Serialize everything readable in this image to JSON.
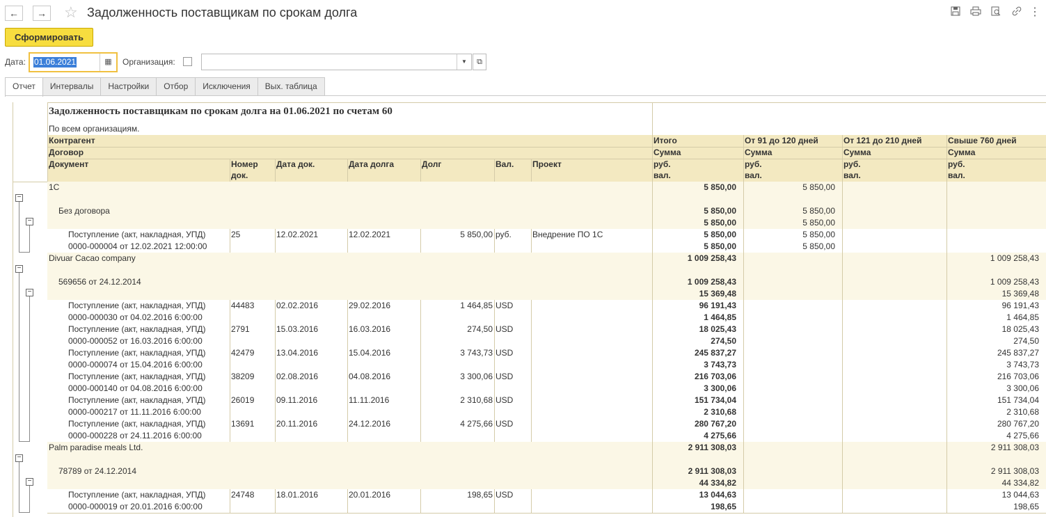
{
  "window": {
    "title": "Задолженность поставщикам по срокам долга",
    "back_icon": "←",
    "forward_icon": "→",
    "star_icon": "☆"
  },
  "toolbar": {
    "generate_label": "Сформировать"
  },
  "filters": {
    "date_label": "Дата:",
    "date_value": "01.06.2021",
    "org_label": "Организация:",
    "org_value": ""
  },
  "tabs": [
    "Отчет",
    "Интервалы",
    "Настройки",
    "Отбор",
    "Исключения",
    "Вых. таблица"
  ],
  "report": {
    "title": "Задолженность поставщикам по срокам долга на 01.06.2021  по счетам 60",
    "subtitle": "По всем организациям.",
    "headers": {
      "counterparty": "Контрагент",
      "contract": "Договор",
      "document": "Документ",
      "doc_number": [
        "Номер",
        "док."
      ],
      "doc_date": "Дата док.",
      "debt_date": "Дата долга",
      "debt": "Долг",
      "currency": "Вал.",
      "project": "Проект",
      "sum": "Сумма",
      "rub": "руб.",
      "val": "вал.",
      "col_total": "Итого",
      "col_91_120": "От 91 до 120 дней",
      "col_121_210": "От 121 до 210 дней",
      "col_760": "Свыше 760 дней"
    },
    "rows": [
      {
        "level": 0,
        "text1": "1С",
        "text2": "",
        "num": "",
        "date1": "",
        "date2": "",
        "debt": "",
        "cur": "",
        "proj": "",
        "total": [
          "5 850,00",
          ""
        ],
        "c91": [
          "5 850,00",
          ""
        ],
        "c121": [
          "",
          ""
        ],
        "c760": [
          "",
          ""
        ]
      },
      {
        "level": 1,
        "text1": "Без договора",
        "text2": "",
        "num": "",
        "date1": "",
        "date2": "",
        "debt": "",
        "cur": "",
        "proj": "",
        "total": [
          "5 850,00",
          "5 850,00"
        ],
        "c91": [
          "5 850,00",
          "5 850,00"
        ],
        "c121": [
          "",
          ""
        ],
        "c760": [
          "",
          ""
        ]
      },
      {
        "level": 2,
        "text1": "Поступление (акт, накладная, УПД)",
        "text2": "0000-000004 от 12.02.2021 12:00:00",
        "num": "25",
        "date1": "12.02.2021",
        "date2": "12.02.2021",
        "debt": "5 850,00",
        "cur": "руб.",
        "proj": "Внедрение ПО 1С",
        "total": [
          "5 850,00",
          "5 850,00"
        ],
        "c91": [
          "5 850,00",
          "5 850,00"
        ],
        "c121": [
          "",
          ""
        ],
        "c760": [
          "",
          ""
        ]
      },
      {
        "level": 0,
        "text1": "Divuar Cacao company",
        "text2": "",
        "num": "",
        "date1": "",
        "date2": "",
        "debt": "",
        "cur": "",
        "proj": "",
        "total": [
          "1 009 258,43",
          ""
        ],
        "c91": [
          "",
          ""
        ],
        "c121": [
          "",
          ""
        ],
        "c760": [
          "1 009 258,43",
          ""
        ]
      },
      {
        "level": 1,
        "text1": "569656 от 24.12.2014",
        "text2": "",
        "num": "",
        "date1": "",
        "date2": "",
        "debt": "",
        "cur": "",
        "proj": "",
        "total": [
          "1 009 258,43",
          "15 369,48"
        ],
        "c91": [
          "",
          ""
        ],
        "c121": [
          "",
          ""
        ],
        "c760": [
          "1 009 258,43",
          "15 369,48"
        ]
      },
      {
        "level": 2,
        "text1": "Поступление (акт, накладная, УПД)",
        "text2": "0000-000030 от 04.02.2016 6:00:00",
        "num": "44483",
        "date1": "02.02.2016",
        "date2": "29.02.2016",
        "debt": "1 464,85",
        "cur": "USD",
        "proj": "",
        "total": [
          "96 191,43",
          "1 464,85"
        ],
        "c91": [
          "",
          ""
        ],
        "c121": [
          "",
          ""
        ],
        "c760": [
          "96 191,43",
          "1 464,85"
        ]
      },
      {
        "level": 2,
        "text1": "Поступление (акт, накладная, УПД)",
        "text2": "0000-000052 от 16.03.2016 6:00:00",
        "num": "2791",
        "date1": "15.03.2016",
        "date2": "16.03.2016",
        "debt": "274,50",
        "cur": "USD",
        "proj": "",
        "total": [
          "18 025,43",
          "274,50"
        ],
        "c91": [
          "",
          ""
        ],
        "c121": [
          "",
          ""
        ],
        "c760": [
          "18 025,43",
          "274,50"
        ]
      },
      {
        "level": 2,
        "text1": "Поступление (акт, накладная, УПД)",
        "text2": "0000-000074 от 15.04.2016 6:00:00",
        "num": "42479",
        "date1": "13.04.2016",
        "date2": "15.04.2016",
        "debt": "3 743,73",
        "cur": "USD",
        "proj": "",
        "total": [
          "245 837,27",
          "3 743,73"
        ],
        "c91": [
          "",
          ""
        ],
        "c121": [
          "",
          ""
        ],
        "c760": [
          "245 837,27",
          "3 743,73"
        ]
      },
      {
        "level": 2,
        "text1": "Поступление (акт, накладная, УПД)",
        "text2": "0000-000140 от 04.08.2016 6:00:00",
        "num": "38209",
        "date1": "02.08.2016",
        "date2": "04.08.2016",
        "debt": "3 300,06",
        "cur": "USD",
        "proj": "",
        "total": [
          "216 703,06",
          "3 300,06"
        ],
        "c91": [
          "",
          ""
        ],
        "c121": [
          "",
          ""
        ],
        "c760": [
          "216 703,06",
          "3 300,06"
        ]
      },
      {
        "level": 2,
        "text1": "Поступление (акт, накладная, УПД)",
        "text2": "0000-000217 от 11.11.2016 6:00:00",
        "num": "26019",
        "date1": "09.11.2016",
        "date2": "11.11.2016",
        "debt": "2 310,68",
        "cur": "USD",
        "proj": "",
        "total": [
          "151 734,04",
          "2 310,68"
        ],
        "c91": [
          "",
          ""
        ],
        "c121": [
          "",
          ""
        ],
        "c760": [
          "151 734,04",
          "2 310,68"
        ]
      },
      {
        "level": 2,
        "text1": "Поступление (акт, накладная, УПД)",
        "text2": "0000-000228 от 24.11.2016 6:00:00",
        "num": "13691",
        "date1": "20.11.2016",
        "date2": "24.12.2016",
        "debt": "4 275,66",
        "cur": "USD",
        "proj": "",
        "total": [
          "280 767,20",
          "4 275,66"
        ],
        "c91": [
          "",
          ""
        ],
        "c121": [
          "",
          ""
        ],
        "c760": [
          "280 767,20",
          "4 275,66"
        ]
      },
      {
        "level": 0,
        "text1": "Palm paradise meals Ltd.",
        "text2": "",
        "num": "",
        "date1": "",
        "date2": "",
        "debt": "",
        "cur": "",
        "proj": "",
        "total": [
          "2 911 308,03",
          ""
        ],
        "c91": [
          "",
          ""
        ],
        "c121": [
          "",
          ""
        ],
        "c760": [
          "2 911 308,03",
          ""
        ]
      },
      {
        "level": 1,
        "text1": "78789 от 24.12.2014",
        "text2": "",
        "num": "",
        "date1": "",
        "date2": "",
        "debt": "",
        "cur": "",
        "proj": "",
        "total": [
          "2 911 308,03",
          "44 334,82"
        ],
        "c91": [
          "",
          ""
        ],
        "c121": [
          "",
          ""
        ],
        "c760": [
          "2 911 308,03",
          "44 334,82"
        ]
      },
      {
        "level": 2,
        "text1": "Поступление (акт, накладная, УПД)",
        "text2": "0000-000019 от 20.01.2016 6:00:00",
        "num": "24748",
        "date1": "18.01.2016",
        "date2": "20.01.2016",
        "debt": "198,65",
        "cur": "USD",
        "proj": "",
        "total": [
          "13 044,63",
          "198,65"
        ],
        "c91": [
          "",
          ""
        ],
        "c121": [
          "",
          ""
        ],
        "c760": [
          "13 044,63",
          "198,65"
        ]
      }
    ]
  },
  "colors": {
    "header_bg": "#f3e9c1",
    "group_bg": "#fbf7e6",
    "accent_button": "#f7dd3f"
  }
}
